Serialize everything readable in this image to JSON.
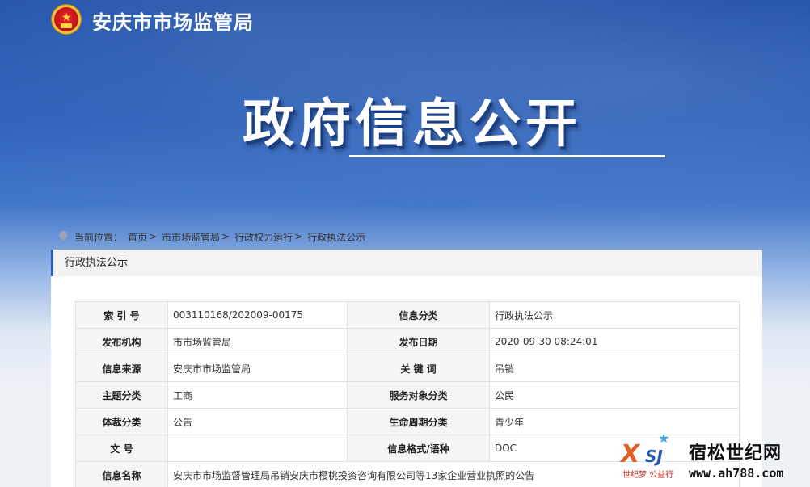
{
  "header": {
    "agency": "安庆市市场监管局",
    "hero_title": "政府信息公开"
  },
  "breadcrumb": {
    "prefix": "当前位置：",
    "items": [
      "首页",
      "市市场监管局",
      "行政权力运行",
      "行政执法公示"
    ],
    "separator": ">"
  },
  "panel": {
    "title": "行政执法公示"
  },
  "info_table": {
    "rows": [
      {
        "l1": "索 引 号",
        "v1": "003110168/202009-00175",
        "l2": "信息分类",
        "v2": "行政执法公示"
      },
      {
        "l1": "发布机构",
        "v1": "市市场监管局",
        "l2": "发布日期",
        "v2": "2020-09-30 08:24:01"
      },
      {
        "l1": "信息来源",
        "v1": "安庆市市场监管局",
        "l2": "关 键 词",
        "v2": "吊销"
      },
      {
        "l1": "主题分类",
        "v1": "工商",
        "l2": "服务对象分类",
        "v2": "公民"
      },
      {
        "l1": "体裁分类",
        "v1": "公告",
        "l2": "生命周期分类",
        "v2": "青少年"
      },
      {
        "l1": "文 号",
        "v1": "",
        "l2": "信息格式/语种",
        "v2": "DOC"
      }
    ],
    "name_row": {
      "label": "信息名称",
      "value": "安庆市市场监督管理局吊销安庆市樱桃投资咨询有限公司等13家企业营业执照的公告"
    }
  },
  "watermark": {
    "logo_text_x": "X",
    "logo_text_sj": "SJ",
    "tagline": "世纪梦 公益行",
    "name": "宿松世纪网",
    "url": "www.ah788.com"
  },
  "colors": {
    "accent": "#2b5fb3",
    "banner_top": "#1d4fa8"
  },
  "icons": {
    "emblem": "national-emblem-icon",
    "location": "location-pin-icon"
  }
}
